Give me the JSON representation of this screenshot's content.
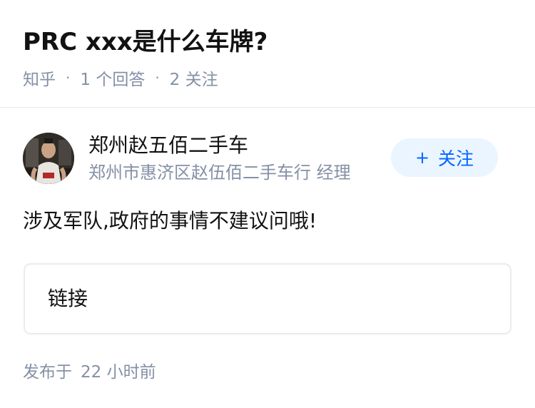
{
  "question": {
    "title": "PRC xxx是什么车牌?",
    "source": "知乎",
    "answers_count": "1",
    "answers_label": "个回答",
    "followers_count": "2",
    "followers_label": "关注"
  },
  "answer": {
    "author": {
      "name": "郑州赵五佰二手车",
      "bio": "郑州市惠济区赵伍佰二手车行 经理",
      "follow_label": "关注",
      "follow_icon": "plus-icon"
    },
    "content": "涉及军队,政府的事情不建议问哦!",
    "link_card_label": "链接",
    "published_prefix": "发布于",
    "published_time": "22 小时前"
  },
  "colors": {
    "title": "#121212",
    "meta": "#8590a6",
    "accent": "#0066ff",
    "follow_bg": "#ebf5ff",
    "border": "#ebebeb"
  }
}
